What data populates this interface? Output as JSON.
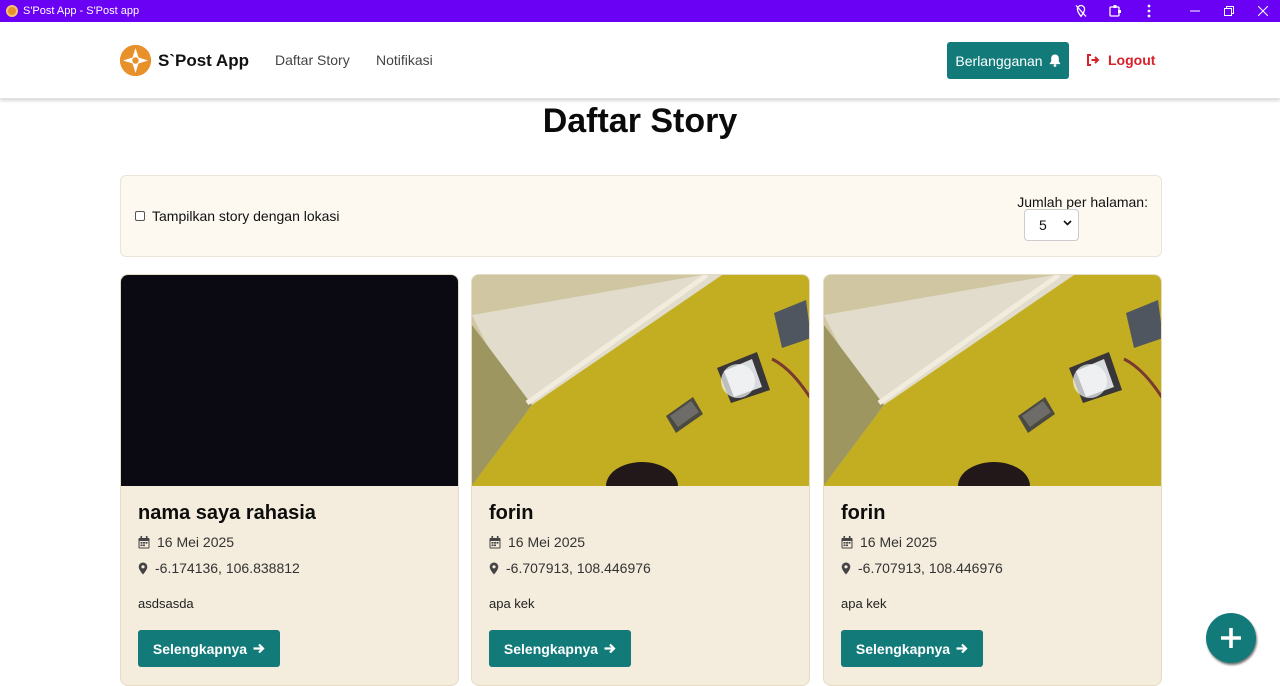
{
  "window": {
    "title": "S'Post App - S'Post app"
  },
  "header": {
    "brand": "S`Post App",
    "nav": [
      "Daftar Story",
      "Notifikasi"
    ],
    "subscribe_label": "Berlangganan",
    "logout_label": "Logout"
  },
  "page": {
    "title": "Daftar Story"
  },
  "filter": {
    "location_label": "Tampilkan story dengan lokasi",
    "location_checked": false,
    "per_page_label": "Jumlah per halaman:",
    "per_page_value": "5"
  },
  "stories": [
    {
      "name": "nama saya rahasia",
      "date": "16 Mei 2025",
      "coords": "-6.174136, 106.838812",
      "description": "asdsasda",
      "button": "Selengkapnya"
    },
    {
      "name": "forin",
      "date": "16 Mei 2025",
      "coords": "-6.707913, 108.446976",
      "description": "apa kek",
      "button": "Selengkapnya"
    },
    {
      "name": "forin",
      "date": "16 Mei 2025",
      "coords": "-6.707913, 108.446976",
      "description": "apa kek",
      "button": "Selengkapnya"
    }
  ],
  "colors": {
    "titlebar": "#6a00f4",
    "primary": "#137a7a",
    "logout": "#d8222a",
    "card": "#f4ecdc",
    "logo": "#e8902a"
  },
  "icons": [
    "compass-logo-icon",
    "bell-icon",
    "logout-icon",
    "calendar-icon",
    "map-pin-icon",
    "arrow-right-icon",
    "plus-icon"
  ]
}
